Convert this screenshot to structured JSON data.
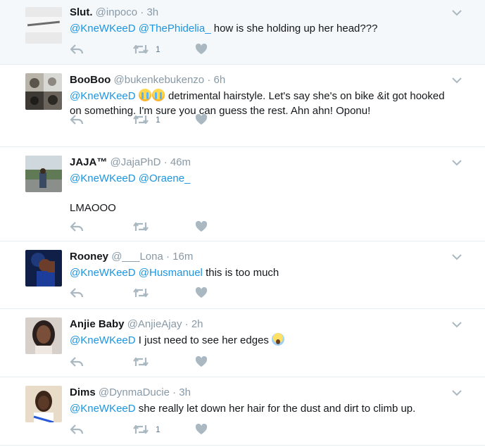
{
  "icons": {
    "reply": "reply-icon",
    "retweet": "retweet-icon",
    "like": "heart-icon",
    "menu": "chevron-down-icon"
  },
  "colors": {
    "link": "#1b95e0",
    "muted": "#8899a6",
    "icon": "#aab8c2",
    "highlight_bg": "#f5f8fa",
    "divider": "#e6ecf0"
  },
  "tweets": [
    {
      "name": "Slut.",
      "handle": "@inpoco",
      "time": "3h",
      "mentions": [
        "@KneWKeeD",
        "@ThePhidelia_"
      ],
      "text": "how is she holding up her head???",
      "retweets": "1",
      "likes": ""
    },
    {
      "name": "BooBoo",
      "handle": "@bukenkebukenzo",
      "time": "6h",
      "mentions": [
        "@KneWKeeD"
      ],
      "emojis": [
        "crying-face",
        "crying-face"
      ],
      "text": "detrimental hairstyle. Let's say she's on bike &it got hooked on something. I'm sure you can guess the rest. Ahn ahn! Oponu!",
      "retweets": "1",
      "likes": ""
    },
    {
      "name": "JAJA™",
      "handle": "@JajaPhD",
      "time": "46m",
      "mentions": [
        "@KneWKeeD",
        "@Oraene_"
      ],
      "text": "",
      "text2": "LMAOOO",
      "retweets": "",
      "likes": ""
    },
    {
      "name": "Rooney",
      "handle": "@___Lona",
      "time": "16m",
      "mentions": [
        "@KneWKeeD",
        "@Husmanuel"
      ],
      "text": "this is too much",
      "retweets": "",
      "likes": ""
    },
    {
      "name": "Anjie Baby",
      "handle": "@AnjieAjay",
      "time": "2h",
      "mentions": [
        "@KneWKeeD"
      ],
      "text": "I just need to see her edges",
      "emoji_after": "screaming-face",
      "retweets": "",
      "likes": ""
    },
    {
      "name": "Dims",
      "handle": "@DynmaDucie",
      "time": "3h",
      "mentions": [
        "@KneWKeeD"
      ],
      "text": "she really let down her hair for the dust and dirt to climb up.",
      "retweets": "1",
      "likes": ""
    }
  ]
}
